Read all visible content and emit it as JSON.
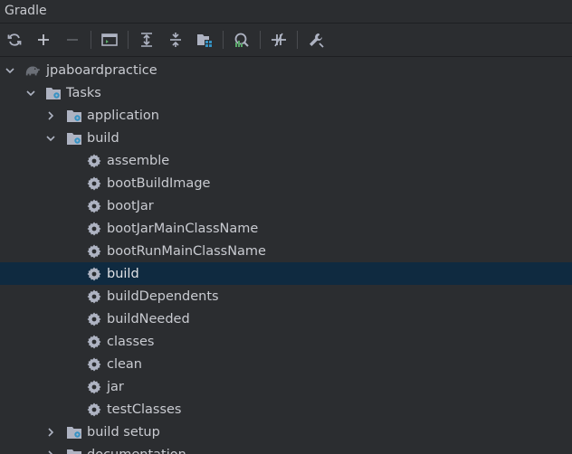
{
  "window": {
    "title": "Gradle"
  },
  "toolbar": {
    "buttons": [
      {
        "icon": "refresh-icon"
      },
      {
        "icon": "plus-icon"
      },
      {
        "icon": "minus-icon"
      },
      {
        "icon": "run-task-icon"
      },
      {
        "icon": "expand-all-icon"
      },
      {
        "icon": "collapse-all-icon"
      },
      {
        "icon": "group-modules-icon"
      },
      {
        "icon": "analyze-dependencies-icon"
      },
      {
        "icon": "toggle-offline-icon"
      },
      {
        "icon": "settings-wrench-icon"
      }
    ]
  },
  "tree": {
    "root": {
      "label": "jpaboardpractice",
      "icon": "gradle-elephant-icon"
    },
    "tasks_label": "Tasks",
    "groups": {
      "application": "application",
      "build": "build",
      "build_setup": "build setup",
      "documentation": "documentation"
    },
    "build_tasks": [
      "assemble",
      "bootBuildImage",
      "bootJar",
      "bootJarMainClassName",
      "bootRunMainClassName",
      "build",
      "buildDependents",
      "buildNeeded",
      "classes",
      "clean",
      "jar",
      "testClasses"
    ],
    "selected_task": "build"
  },
  "colors": {
    "background": "#2b2d30",
    "selection": "#0f2a40",
    "text": "#c9cbd1",
    "icon_blue": "#3592c4",
    "icon_gray": "#aeb3c2"
  }
}
